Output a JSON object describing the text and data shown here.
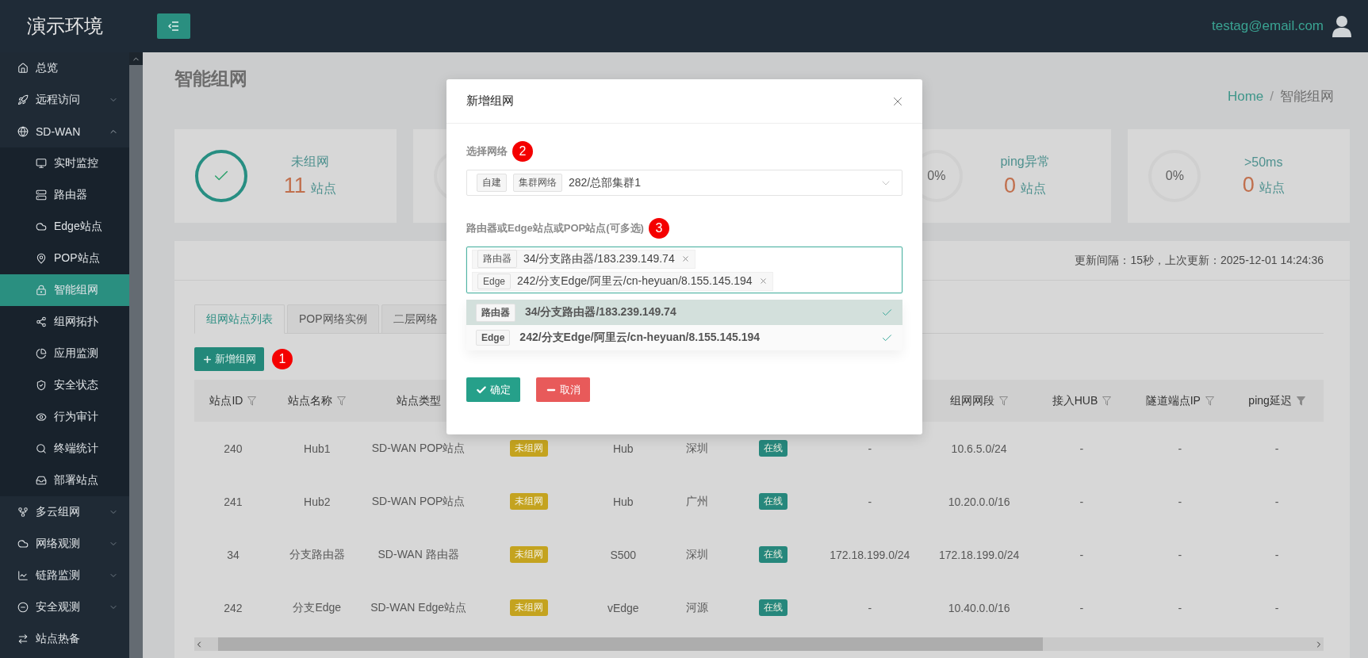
{
  "app": {
    "title": "演示环境"
  },
  "header": {
    "user": "testag@email.com"
  },
  "sidebar": {
    "items": [
      {
        "label": "总览",
        "kind": "link",
        "selected": false
      },
      {
        "label": "远程访问",
        "kind": "group",
        "expanded": false,
        "selected": false
      },
      {
        "label": "SD-WAN",
        "kind": "group",
        "expanded": true,
        "selected": false,
        "children": [
          {
            "label": "实时监控",
            "selected": false
          },
          {
            "label": "路由器",
            "selected": false
          },
          {
            "label": "Edge站点",
            "selected": false
          },
          {
            "label": "POP站点",
            "selected": false
          },
          {
            "label": "智能组网",
            "selected": true
          },
          {
            "label": "组网拓扑",
            "selected": false
          },
          {
            "label": "应用监测",
            "selected": false
          },
          {
            "label": "安全状态",
            "selected": false
          },
          {
            "label": "行为审计",
            "selected": false
          },
          {
            "label": "终端统计",
            "selected": false
          },
          {
            "label": "部署站点",
            "selected": false
          }
        ]
      },
      {
        "label": "多云组网",
        "kind": "group",
        "expanded": false,
        "selected": false
      },
      {
        "label": "网络观测",
        "kind": "group",
        "expanded": false,
        "selected": false
      },
      {
        "label": "链路监测",
        "kind": "group",
        "expanded": false,
        "selected": false
      },
      {
        "label": "安全观测",
        "kind": "group",
        "expanded": false,
        "selected": false
      },
      {
        "label": "站点热备",
        "kind": "link",
        "selected": false
      }
    ]
  },
  "page": {
    "title": "智能组网",
    "breadcrumb_separator": "/",
    "breadcrumb": [
      {
        "label": "Home",
        "kind": "link"
      },
      {
        "label": "智能组网",
        "kind": "current"
      }
    ]
  },
  "stats": [
    {
      "kind": "check",
      "label": "未组网",
      "value": "11",
      "unit": "站点"
    },
    {
      "kind": "percent",
      "percent": "0%",
      "label": "ping异常",
      "value": "0",
      "unit": "站点"
    },
    {
      "kind": "percent",
      "percent": "0%",
      "label": ">50ms",
      "value": "0",
      "unit": "站点"
    }
  ],
  "panel": {
    "update_info": "更新间隔：15秒，上次更新：2025-12-01 14:24:36",
    "tabs": [
      {
        "label": "组网站点列表",
        "selected": true
      },
      {
        "label": "POP网络实例",
        "selected": false
      },
      {
        "label": "二层网络",
        "selected": false
      }
    ],
    "add_button": "新增组网",
    "add_step": "1",
    "table": {
      "columns": [
        {
          "label": "站点ID",
          "filter": true,
          "filter_active": false
        },
        {
          "label": "站点名称",
          "filter": true,
          "filter_active": false
        },
        {
          "label": "站点类型",
          "filter": false
        },
        null,
        null,
        null,
        null,
        null,
        {
          "label": "组网网段",
          "filter": true,
          "filter_active": false
        },
        {
          "label": "接入HUB",
          "filter": true,
          "filter_active": false
        },
        {
          "label": "隧道端点IP",
          "filter": true,
          "filter_active": false
        },
        {
          "label": "ping延迟",
          "filter": true,
          "filter_active": true
        }
      ],
      "rows": [
        {
          "cells": [
            {
              "kind": "text",
              "text": "240"
            },
            {
              "kind": "text",
              "text": "Hub1"
            },
            {
              "kind": "text",
              "text": "SD-WAN POP站点"
            },
            {
              "kind": "tag",
              "text": "未组网",
              "color": "#c4a31f"
            },
            {
              "kind": "text",
              "text": "Hub"
            },
            {
              "kind": "text",
              "text": "深圳"
            },
            {
              "kind": "tag",
              "text": "在线",
              "color": "#26877c"
            },
            {
              "kind": "text",
              "text": "-"
            },
            {
              "kind": "text",
              "text": "10.6.5.0/24"
            },
            {
              "kind": "text",
              "text": "-"
            },
            {
              "kind": "text",
              "text": "-"
            },
            {
              "kind": "text",
              "text": "-"
            }
          ]
        },
        {
          "cells": [
            {
              "kind": "text",
              "text": "241"
            },
            {
              "kind": "text",
              "text": "Hub2"
            },
            {
              "kind": "text",
              "text": "SD-WAN POP站点"
            },
            {
              "kind": "tag",
              "text": "未组网",
              "color": "#c4a31f"
            },
            {
              "kind": "text",
              "text": "Hub"
            },
            {
              "kind": "text",
              "text": "广州"
            },
            {
              "kind": "tag",
              "text": "在线",
              "color": "#26877c"
            },
            {
              "kind": "text",
              "text": "-"
            },
            {
              "kind": "text",
              "text": "10.20.0.0/16"
            },
            {
              "kind": "text",
              "text": "-"
            },
            {
              "kind": "text",
              "text": "-"
            },
            {
              "kind": "text",
              "text": "-"
            }
          ]
        },
        {
          "cells": [
            {
              "kind": "text",
              "text": "34"
            },
            {
              "kind": "text",
              "text": "分支路由器"
            },
            {
              "kind": "text",
              "text": "SD-WAN 路由器"
            },
            {
              "kind": "tag",
              "text": "未组网",
              "color": "#c4a31f"
            },
            {
              "kind": "text",
              "text": "S500"
            },
            {
              "kind": "text",
              "text": "深圳"
            },
            {
              "kind": "tag",
              "text": "在线",
              "color": "#26877c"
            },
            {
              "kind": "text",
              "text": "172.18.199.0/24"
            },
            {
              "kind": "text",
              "text": "172.18.199.0/24"
            },
            {
              "kind": "text",
              "text": "-"
            },
            {
              "kind": "text",
              "text": "-"
            },
            {
              "kind": "text",
              "text": "-"
            }
          ]
        },
        {
          "cells": [
            {
              "kind": "text",
              "text": "242"
            },
            {
              "kind": "text",
              "text": "分支Edge"
            },
            {
              "kind": "text",
              "text": "SD-WAN Edge站点"
            },
            {
              "kind": "tag",
              "text": "未组网",
              "color": "#c4a31f"
            },
            {
              "kind": "text",
              "text": "vEdge"
            },
            {
              "kind": "text",
              "text": "河源"
            },
            {
              "kind": "tag",
              "text": "在线",
              "color": "#26877c"
            },
            {
              "kind": "text",
              "text": "-"
            },
            {
              "kind": "text",
              "text": "10.40.0.0/16"
            },
            {
              "kind": "text",
              "text": "-"
            },
            {
              "kind": "text",
              "text": "-"
            },
            {
              "kind": "text",
              "text": "-"
            }
          ]
        }
      ]
    }
  },
  "modal": {
    "title": "新增组网",
    "fields": [
      {
        "kind": "select",
        "label": "选择网络",
        "step": "2",
        "tags": [
          "自建",
          "集群网络"
        ],
        "value": "282/总部集群1"
      },
      {
        "kind": "multiselect",
        "label": "路由器或Edge站点或POP站点(可多选)",
        "step": "3",
        "focused": true,
        "chips": [
          {
            "tag": "路由器",
            "text": "34/分支路由器/183.239.149.74"
          },
          {
            "tag": "Edge",
            "text": "242/分支Edge/阿里云/cn-heyuan/8.155.145.194"
          }
        ],
        "options": [
          {
            "tag": "路由器",
            "text": "34/分支路由器/183.239.149.74",
            "selected": true,
            "highlighted": true
          },
          {
            "tag": "Edge",
            "text": "242/分支Edge/阿里云/cn-heyuan/8.155.145.194",
            "selected": true,
            "highlighted": false
          }
        ]
      }
    ],
    "buttons": [
      {
        "label": "确定",
        "kind": "primary"
      },
      {
        "label": "取消",
        "kind": "danger"
      }
    ]
  }
}
